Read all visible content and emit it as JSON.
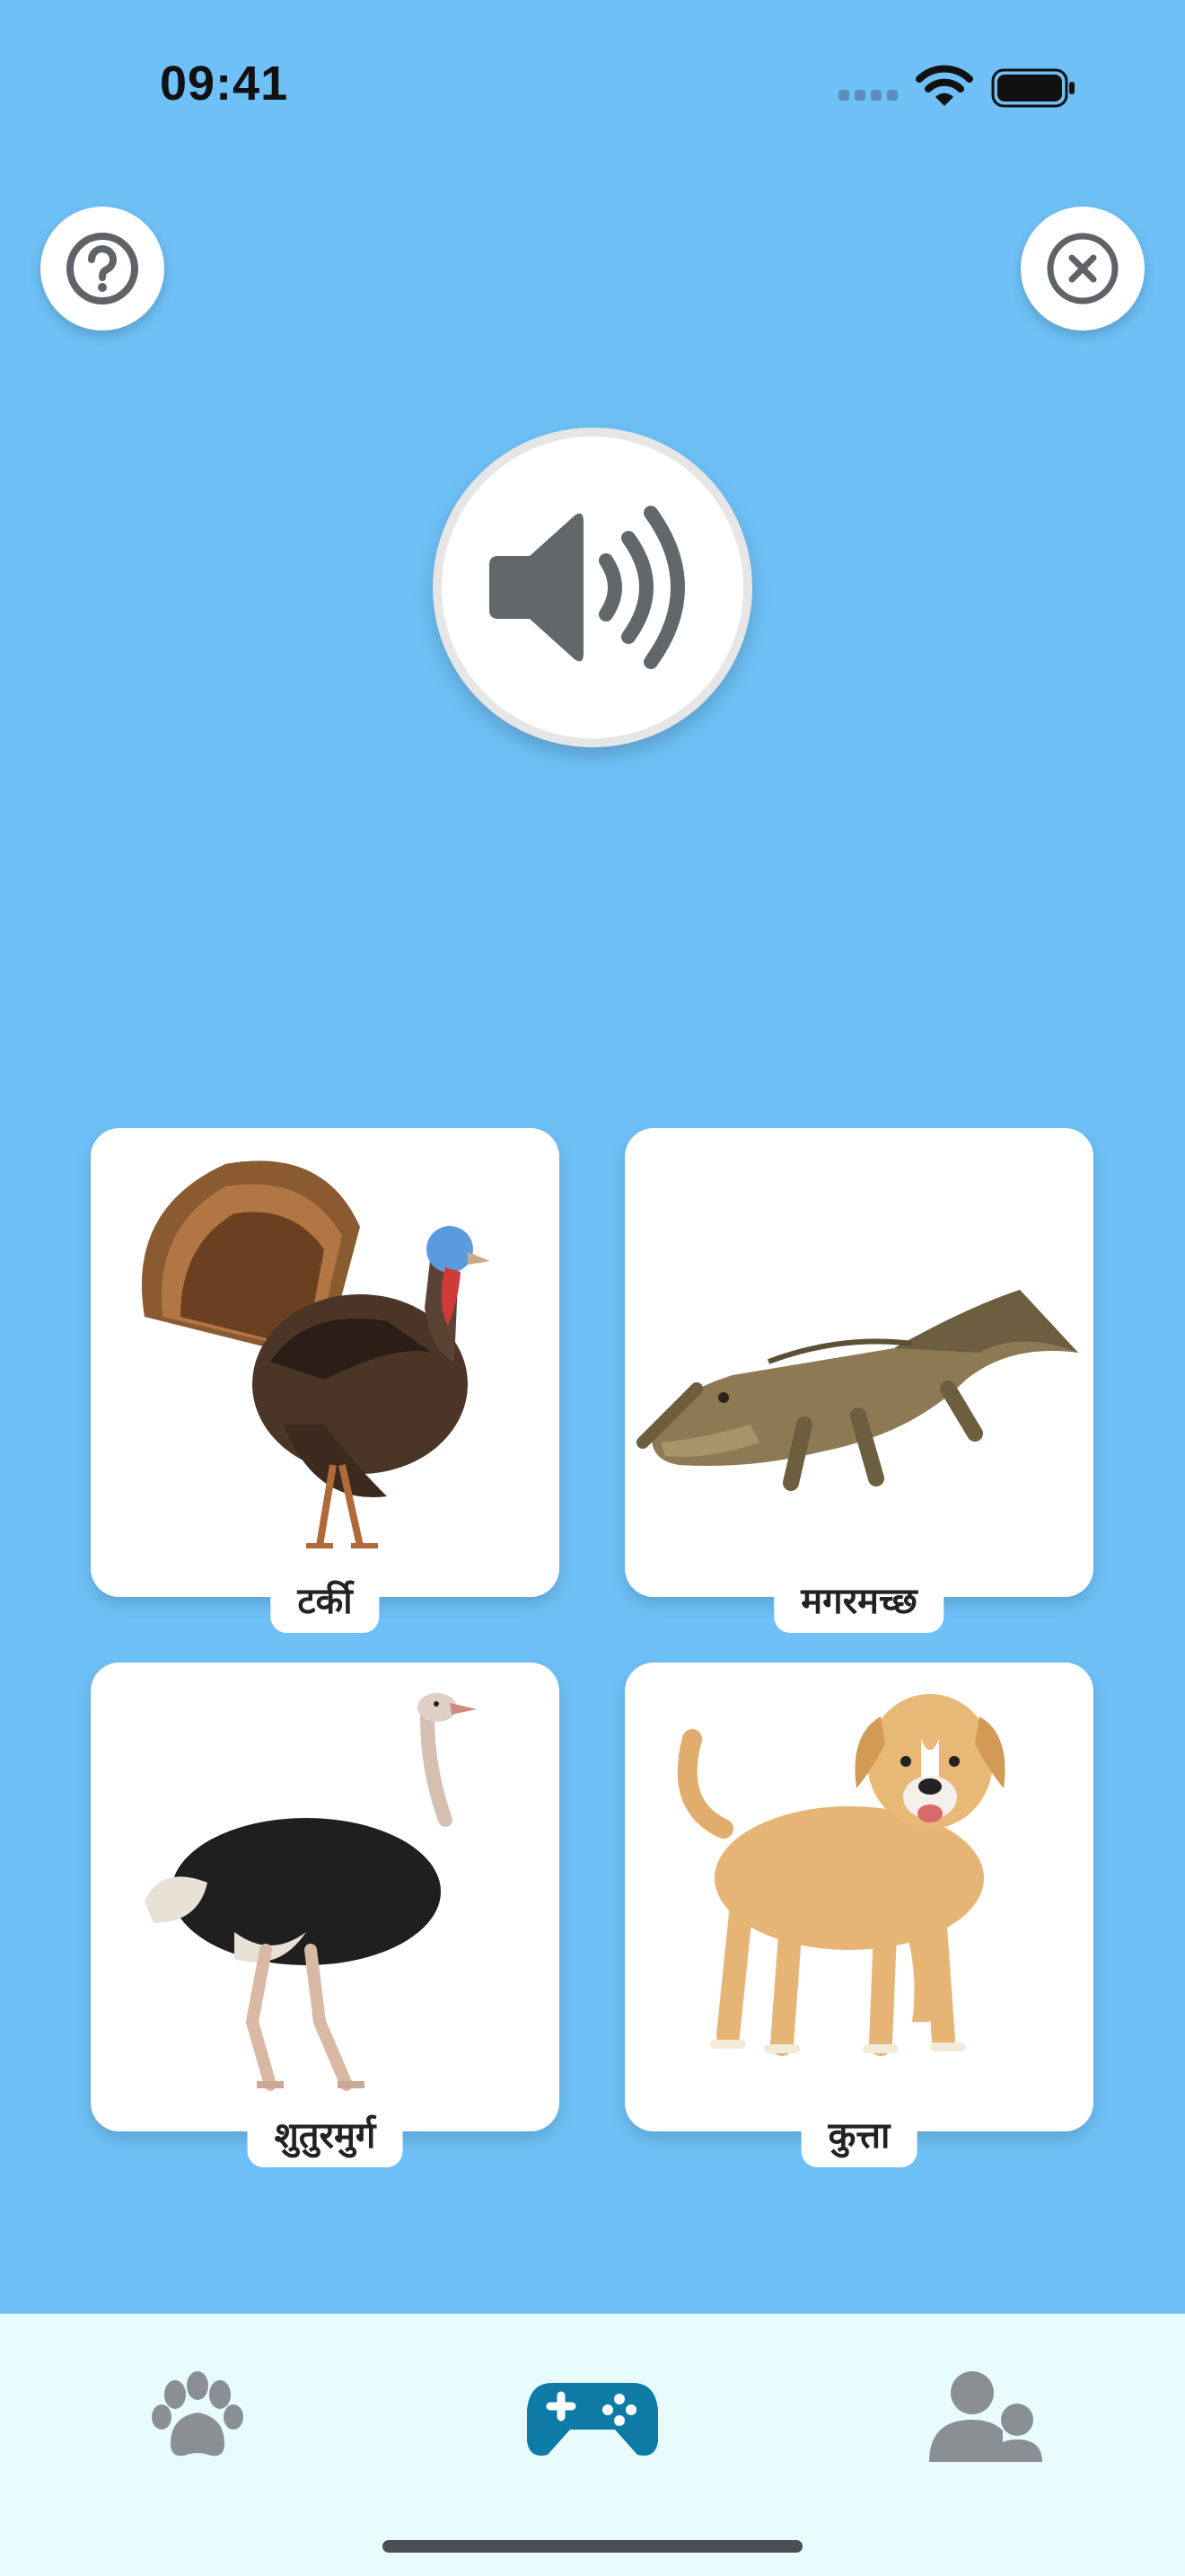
{
  "status_bar": {
    "time": "09:41"
  },
  "header": {
    "help_icon": "question-circle-icon",
    "close_icon": "close-circle-icon"
  },
  "sound_button": {
    "icon": "speaker-wave-icon"
  },
  "cards": [
    {
      "label": "टर्की",
      "animal": "turkey"
    },
    {
      "label": "मगरमच्छ",
      "animal": "crocodile"
    },
    {
      "label": "शुतुरमुर्ग",
      "animal": "ostrich"
    },
    {
      "label": "कुत्ता",
      "animal": "dog"
    }
  ],
  "tab_bar": {
    "tabs": [
      {
        "icon": "paw-icon",
        "active": false
      },
      {
        "icon": "gamepad-icon",
        "active": true
      },
      {
        "icon": "users-icon",
        "active": false
      }
    ],
    "active_color": "#0e7aa6",
    "inactive_color": "#8a8f94"
  },
  "colors": {
    "background": "#6ec0f7",
    "tab_bar_background": "#e8fcfd"
  }
}
